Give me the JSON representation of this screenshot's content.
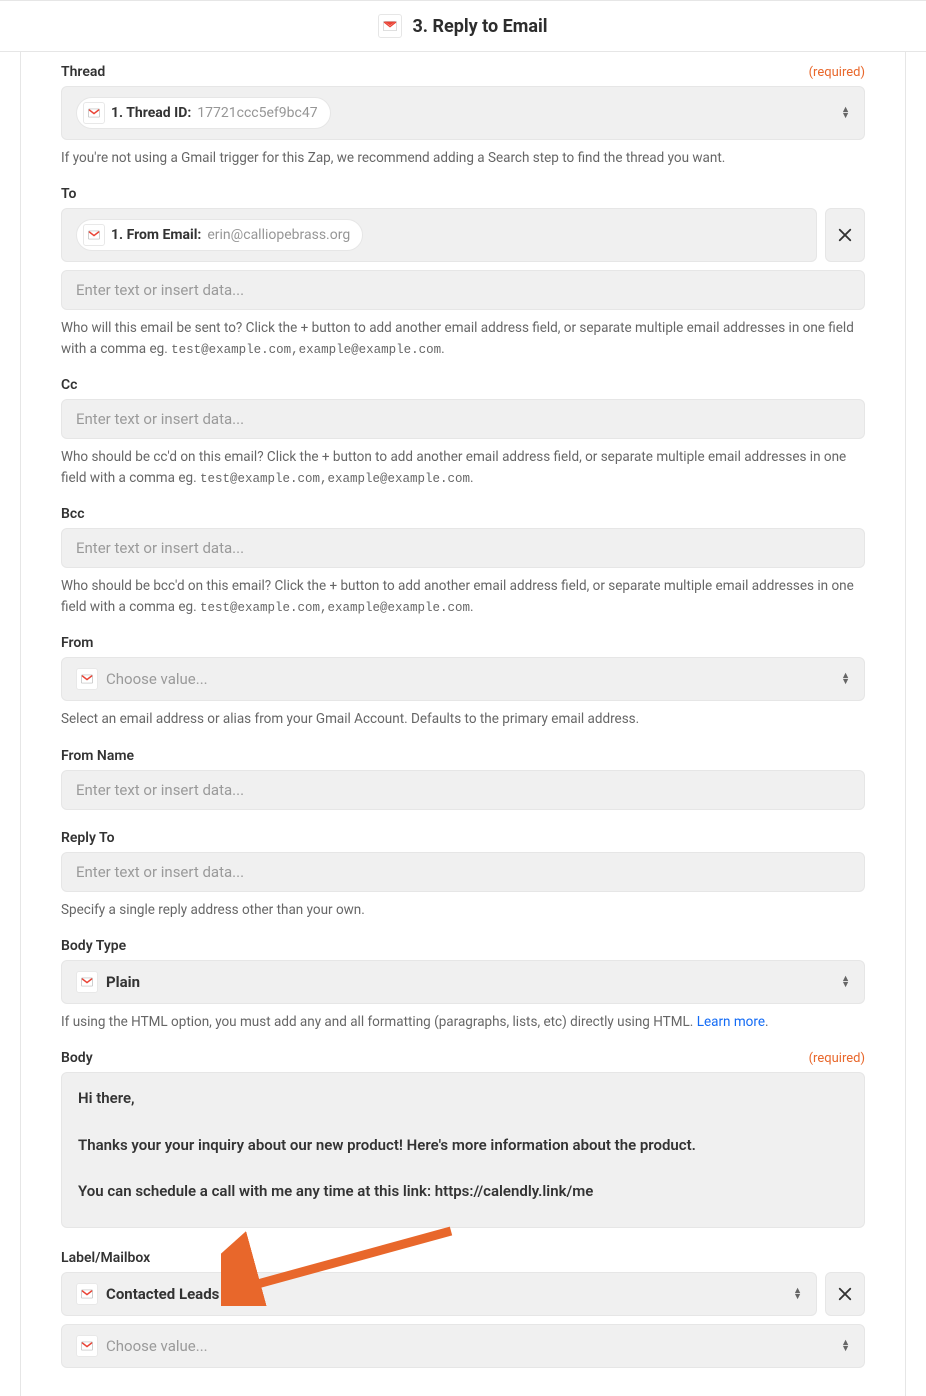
{
  "header": {
    "title": "3. Reply to Email"
  },
  "thread": {
    "label": "Thread",
    "required_text": "(required)",
    "pill_label": "1. Thread ID:",
    "pill_value": "17721ccc5ef9bc47",
    "help": "If you're not using a Gmail trigger for this Zap, we recommend adding a Search step to find the thread you want."
  },
  "to": {
    "label": "To",
    "pill_label": "1. From Email:",
    "pill_value": "erin@calliopebrass.org",
    "placeholder": "Enter text or insert data...",
    "help_pre": "Who will this email be sent to? Click the + button to add another email address field, or separate multiple email addresses in one field with a comma eg. ",
    "help_code": "test@example.com,example@example.com"
  },
  "cc": {
    "label": "Cc",
    "placeholder": "Enter text or insert data...",
    "help_pre": "Who should be cc'd on this email? Click the + button to add another email address field, or separate multiple email addresses in one field with a comma eg. ",
    "help_code": "test@example.com,example@example.com"
  },
  "bcc": {
    "label": "Bcc",
    "placeholder": "Enter text or insert data...",
    "help_pre": "Who should be bcc'd on this email? Click the + button to add another email address field, or separate multiple email addresses in one field with a comma eg. ",
    "help_code": "test@example.com,example@example.com"
  },
  "from": {
    "label": "From",
    "placeholder": "Choose value...",
    "help": "Select an email address or alias from your Gmail Account. Defaults to the primary email address."
  },
  "from_name": {
    "label": "From Name",
    "placeholder": "Enter text or insert data..."
  },
  "reply_to": {
    "label": "Reply To",
    "placeholder": "Enter text or insert data...",
    "help": "Specify a single reply address other than your own."
  },
  "body_type": {
    "label": "Body Type",
    "value": "Plain",
    "help_pre": "If using the HTML option, you must add any and all formatting (paragraphs, lists, etc) directly using HTML. ",
    "learn_more": "Learn more"
  },
  "body": {
    "label": "Body",
    "required_text": "(required)",
    "line1": "Hi there,",
    "line2": "Thanks your your inquiry about our new product! Here's more information about the product.",
    "line3": "You can schedule a call with me any time at this link: https://calendly.link/me"
  },
  "label_mailbox": {
    "label": "Label/Mailbox",
    "value": "Contacted Leads",
    "placeholder": "Choose value..."
  }
}
